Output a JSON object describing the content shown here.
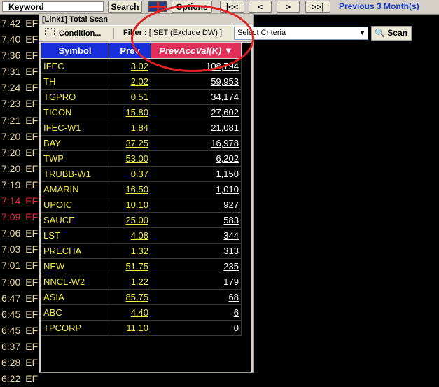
{
  "toolbar": {
    "keyword_label": "Keyword",
    "search_label": "Search",
    "options_label": "Options",
    "first_label": "|<<",
    "prev_label": "<",
    "next_label": ">",
    "last_label": ">>|",
    "range_label": "Previous 3 Month(s)"
  },
  "ticker": [
    {
      "time": "7:42",
      "code": "EF",
      "alert": false
    },
    {
      "time": "7:40",
      "code": "EF",
      "alert": false
    },
    {
      "time": "7:36",
      "code": "EF",
      "alert": false
    },
    {
      "time": "7:31",
      "code": "EF",
      "alert": false
    },
    {
      "time": "7:24",
      "code": "EF",
      "alert": false
    },
    {
      "time": "7:23",
      "code": "EF",
      "alert": false
    },
    {
      "time": "7:21",
      "code": "EF",
      "alert": false
    },
    {
      "time": "7:20",
      "code": "EF",
      "alert": false
    },
    {
      "time": "7:20",
      "code": "EF",
      "alert": false
    },
    {
      "time": "7:20",
      "code": "EF",
      "alert": false
    },
    {
      "time": "7:19",
      "code": "EF",
      "alert": false
    },
    {
      "time": "7:14",
      "code": "EF",
      "alert": true
    },
    {
      "time": "7:09",
      "code": "EF",
      "alert": true
    },
    {
      "time": "7:06",
      "code": "EF",
      "alert": false
    },
    {
      "time": "7:03",
      "code": "EF",
      "alert": false
    },
    {
      "time": "7:01",
      "code": "EF",
      "alert": false
    },
    {
      "time": "7:00",
      "code": "EF",
      "alert": false
    },
    {
      "time": "6:47",
      "code": "EF",
      "alert": false
    },
    {
      "time": "6:45",
      "code": "EF",
      "alert": false
    },
    {
      "time": "6:45",
      "code": "EF",
      "alert": false
    },
    {
      "time": "6:37",
      "code": "EF",
      "alert": false
    },
    {
      "time": "6:28",
      "code": "EF",
      "alert": false
    },
    {
      "time": "6:22",
      "code": "EF",
      "alert": false
    }
  ],
  "panel": {
    "title": "[Link1] Total Scan",
    "condition_label": "Condition...",
    "filter_label": "Filter :",
    "filter_value": "[ SET (Exclude DW) ]",
    "criteria_placeholder": "Select Criteria",
    "scan_label": "Scan"
  },
  "table": {
    "columns": [
      "Symbol",
      "Prev",
      "PrevAccVal(K) ▼"
    ],
    "rows": [
      {
        "symbol": "IFEC",
        "prev": "3.02",
        "acc": "108,794"
      },
      {
        "symbol": "TH",
        "prev": "2.02",
        "acc": "59,953"
      },
      {
        "symbol": "TGPRO",
        "prev": "0.51",
        "acc": "34,174"
      },
      {
        "symbol": "TICON",
        "prev": "15.80",
        "acc": "27,602"
      },
      {
        "symbol": "IFEC-W1",
        "prev": "1.84",
        "acc": "21,081"
      },
      {
        "symbol": "BAY",
        "prev": "37.25",
        "acc": "16,978"
      },
      {
        "symbol": "TWP",
        "prev": "53.00",
        "acc": "6,202"
      },
      {
        "symbol": "TRUBB-W1",
        "prev": "0.37",
        "acc": "1,150"
      },
      {
        "symbol": "AMARIN",
        "prev": "16.50",
        "acc": "1,010"
      },
      {
        "symbol": "UPOIC",
        "prev": "10.10",
        "acc": "927"
      },
      {
        "symbol": "SAUCE",
        "prev": "25.00",
        "acc": "583"
      },
      {
        "symbol": "LST",
        "prev": "4.08",
        "acc": "344"
      },
      {
        "symbol": "PRECHA",
        "prev": "1.32",
        "acc": "313"
      },
      {
        "symbol": "NEW",
        "prev": "51.75",
        "acc": "235"
      },
      {
        "symbol": "NNCL-W2",
        "prev": "1.22",
        "acc": "179"
      },
      {
        "symbol": "ASIA",
        "prev": "85.75",
        "acc": "68"
      },
      {
        "symbol": "ABC",
        "prev": "4.40",
        "acc": "6"
      },
      {
        "symbol": "TPCORP",
        "prev": "11.10",
        "acc": "0"
      }
    ]
  },
  "colors": {
    "header_blue": "#1a2fdc",
    "sorted_header": "#e0305a",
    "value_yellow": "#f0ec40",
    "annotation_red": "#e02020"
  }
}
